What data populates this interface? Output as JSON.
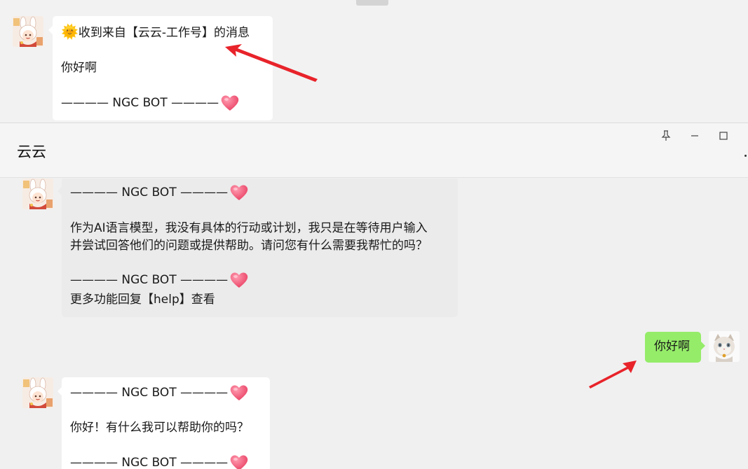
{
  "notification": {
    "title_emoji": "🌞",
    "title": "收到来自【云云-工作号】的消息",
    "body": "你好啊",
    "signature": "———— NGC BOT ————"
  },
  "chat": {
    "title": "云云",
    "window_controls": [
      "pin-icon",
      "minimize-icon",
      "maximize-icon"
    ],
    "messages": [
      {
        "sender": "bot",
        "signature_top": "———— NGC BOT ————",
        "text_line1": "作为AI语言模型，我没有具体的行动或计划，我只是在等待用户输入",
        "text_line2": "并尝试回答他们的问题或提供帮助。请问您有什么需要我帮忙的吗？",
        "signature_bottom": "———— NGC BOT ————",
        "footer": "更多功能回复【help】查看"
      },
      {
        "sender": "me",
        "text": "你好啊"
      },
      {
        "sender": "bot",
        "signature_top": "———— NGC BOT ————",
        "text": "你好！有什么我可以帮助你的吗？",
        "signature_bottom": "———— NGC BOT ————"
      }
    ]
  },
  "colors": {
    "arrow": "#e8232a",
    "my_bubble": "#95ec69",
    "bot_bubble": "#ebebeb",
    "heart": "#f0506e"
  }
}
